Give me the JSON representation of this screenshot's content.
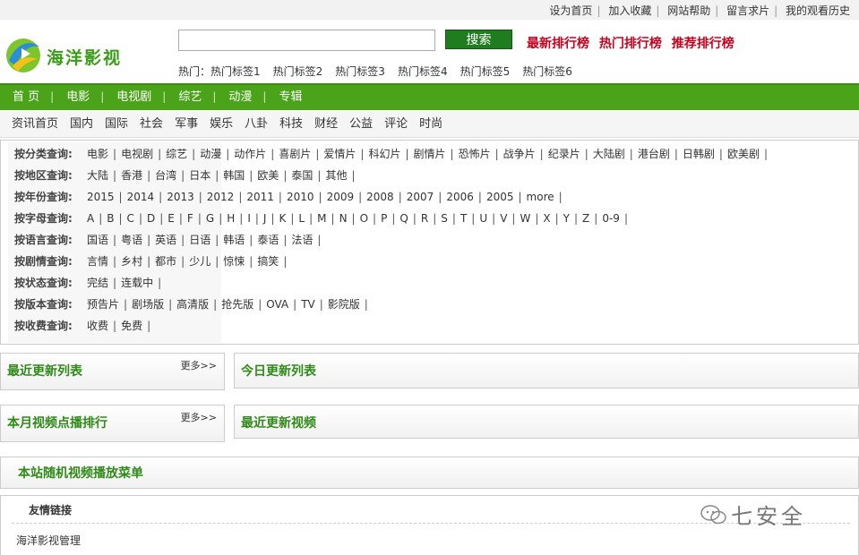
{
  "toplinks": [
    "设为首页",
    "加入收藏",
    "网站帮助",
    "留言求片",
    "我的观看历史"
  ],
  "logo": {
    "text": "海洋影视"
  },
  "search": {
    "placeholder": "",
    "value": "",
    "button": "搜索"
  },
  "ranks": [
    "最新排行榜",
    "热门排行榜",
    "推荐排行榜"
  ],
  "hot": {
    "label": "热门：",
    "tags": [
      "热门标签1",
      "热门标签2",
      "热门标签3",
      "热门标签4",
      "热门标签5",
      "热门标签6"
    ]
  },
  "mainnav": [
    "首 页",
    "电影",
    "电视剧",
    "综艺",
    "动漫",
    "专辑"
  ],
  "subnav": [
    "资讯首页",
    "国内",
    "国际",
    "社会",
    "军事",
    "娱乐",
    "八卦",
    "科技",
    "财经",
    "公益",
    "评论",
    "时尚"
  ],
  "filters": [
    {
      "label": "按分类查询:",
      "options": [
        "电影",
        "电视剧",
        "综艺",
        "动漫",
        "动作片",
        "喜剧片",
        "爱情片",
        "科幻片",
        "剧情片",
        "恐怖片",
        "战争片",
        "纪录片",
        "大陆剧",
        "港台剧",
        "日韩剧",
        "欧美剧"
      ]
    },
    {
      "label": "按地区查询:",
      "options": [
        "大陆",
        "香港",
        "台湾",
        "日本",
        "韩国",
        "欧美",
        "泰国",
        "其他"
      ]
    },
    {
      "label": "按年份查询:",
      "options": [
        "2015",
        "2014",
        "2013",
        "2012",
        "2011",
        "2010",
        "2009",
        "2008",
        "2007",
        "2006",
        "2005",
        "more"
      ]
    },
    {
      "label": "按字母查询:",
      "options": [
        "A",
        "B",
        "C",
        "D",
        "E",
        "F",
        "G",
        "H",
        "I",
        "J",
        "K",
        "L",
        "M",
        "N",
        "O",
        "P",
        "Q",
        "R",
        "S",
        "T",
        "U",
        "V",
        "W",
        "X",
        "Y",
        "Z",
        "0-9"
      ]
    },
    {
      "label": "按语言查询:",
      "options": [
        "国语",
        "粤语",
        "英语",
        "日语",
        "韩语",
        "泰语",
        "法语"
      ]
    },
    {
      "label": "按剧情查询:",
      "options": [
        "言情",
        "乡村",
        "都市",
        "少儿",
        "惊悚",
        "搞笑"
      ]
    },
    {
      "label": "按状态查询:",
      "options": [
        "完结",
        "连载中"
      ]
    },
    {
      "label": "按版本查询:",
      "options": [
        "预告片",
        "剧场版",
        "高清版",
        "抢先版",
        "OVA",
        "TV",
        "影院版"
      ]
    },
    {
      "label": "按收费查询:",
      "options": [
        "收费",
        "免费"
      ]
    }
  ],
  "boxes": {
    "recent_list": {
      "title": "最近更新列表",
      "more": "更多>>"
    },
    "today_list": {
      "title": "今日更新列表"
    },
    "month_rank": {
      "title": "本月视频点播排行",
      "more": "更多>>"
    },
    "recent_video": {
      "title": "最近更新视频"
    },
    "random_menu": {
      "title": "本站随机视频播放菜单"
    }
  },
  "friend": {
    "title": "友情链接",
    "links": [
      "海洋影视管理"
    ]
  },
  "watermark": "七安全",
  "colors": {
    "green": "#4aa319",
    "rank_red": "#c8001e",
    "title_green": "#2f8a18"
  }
}
